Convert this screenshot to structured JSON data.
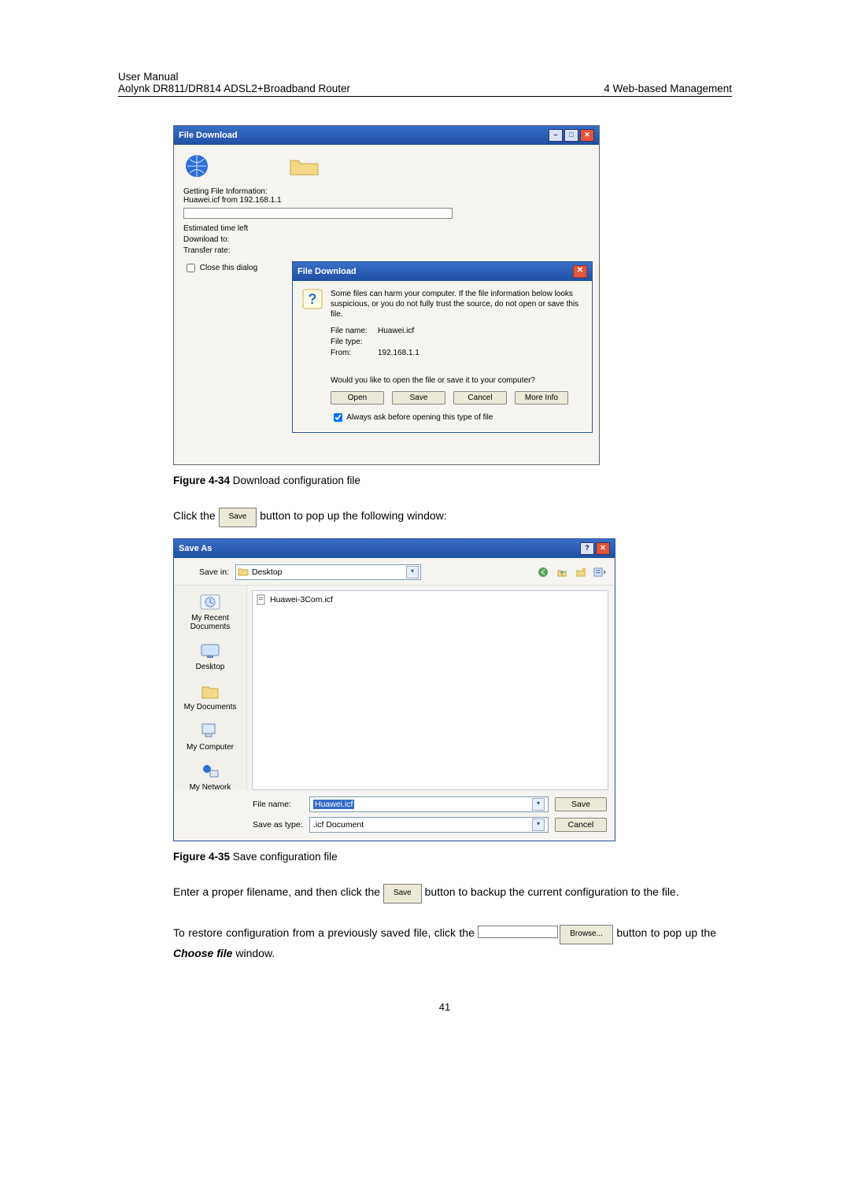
{
  "header": {
    "manual": "User Manual",
    "product": "Aolynk DR811/DR814 ADSL2+Broadband Router",
    "section": "4  Web-based Management"
  },
  "progress_dialog": {
    "title": "File Download",
    "getting": "Getting File Information:",
    "source": "Huawei.icf from 192.168.1.1",
    "est_label": "Estimated time left",
    "dl_label": "Download to:",
    "rate_label": "Transfer rate:",
    "close_check": "Close this dialog"
  },
  "security_dialog": {
    "title": "File Download",
    "warning": "Some files can harm your computer. If the file information below looks suspicious, or you do not fully trust the source, do not open or save this file.",
    "filename_label": "File name:",
    "filename": "Huawei.icf",
    "filetype_label": "File type:",
    "filetype": "",
    "from_label": "From:",
    "from": "192.168.1.1",
    "question": "Would you like to open the file or save it to your computer?",
    "btn_open": "Open",
    "btn_save": "Save",
    "btn_cancel": "Cancel",
    "btn_more": "More Info",
    "always_ask": "Always ask before opening this type of file"
  },
  "caption1_bold": "Figure 4-34 ",
  "caption1_rest": "Download configuration file",
  "line1_pre": "Click the ",
  "line1_btn": "Save",
  "line1_post": " button to pop up the following window:",
  "saveas": {
    "title": "Save As",
    "savein_label": "Save in:",
    "savein_value": "Desktop",
    "file_listed": "Huawei-3Com.icf",
    "places": {
      "recent": "My Recent Documents",
      "desktop": "Desktop",
      "mydocs": "My Documents",
      "mycomp": "My Computer",
      "mynet": "My Network"
    },
    "filename_label": "File name:",
    "filename_value": "Huawei.icf",
    "type_label": "Save as type:",
    "type_value": ".icf Document",
    "btn_save": "Save",
    "btn_cancel": "Cancel"
  },
  "caption2_bold": "Figure 4-35 ",
  "caption2_rest": "Save configuration file",
  "para2_pre": "Enter a proper filename, and then click the ",
  "para2_btn": "Save",
  "para2_post": " button to backup the current configuration to the file.",
  "para3_pre": "To restore configuration from a previously saved file, click the ",
  "para3_btn": "Browse...",
  "para3_mid": " button to pop up the ",
  "para3_em": "Choose file",
  "para3_post": " window.",
  "pagenum": "41"
}
